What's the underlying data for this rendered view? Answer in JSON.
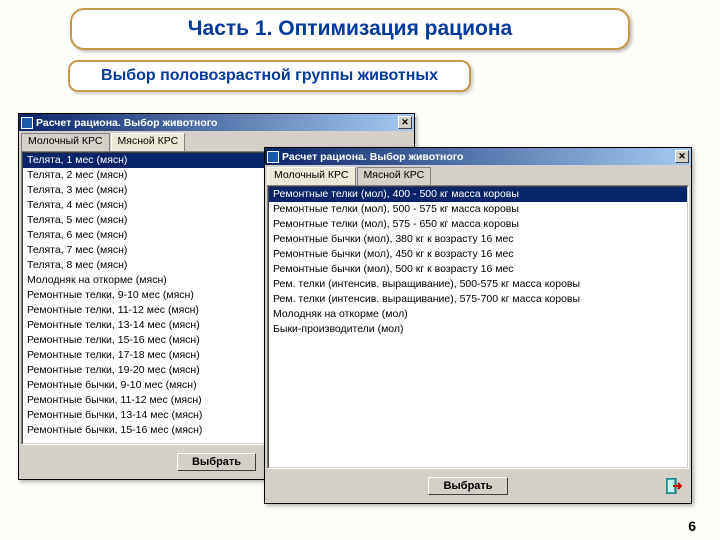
{
  "slide": {
    "title": "Часть 1. Оптимизация рациона",
    "subtitle": "Выбор половозрастной группы животных",
    "page_number": "6"
  },
  "window1": {
    "title": "Расчет рациона. Выбор животного",
    "tabs": [
      "Молочный КРС",
      "Мясной КРС"
    ],
    "active_tab": 1,
    "items": [
      "Телята, 1 мес (мясн)",
      "Телята, 2 мес (мясн)",
      "Телята, 3 мес (мясн)",
      "Телята, 4 мес (мясн)",
      "Телята, 5 мес (мясн)",
      "Телята, 6 мес (мясн)",
      "Телята, 7 мес (мясн)",
      "Телята, 8 мес (мясн)",
      "Молодняк на откорме (мясн)",
      "Ремонтные телки, 9-10 мес (мясн)",
      "Ремонтные телки, 11-12 мес (мясн)",
      "Ремонтные телки, 13-14 мес (мясн)",
      "Ремонтные телки, 15-16 мес (мясн)",
      "Ремонтные телки, 17-18 мес (мясн)",
      "Ремонтные телки, 19-20 мес (мясн)",
      "Ремонтные бычки, 9-10 мес (мясн)",
      "Ремонтные бычки, 11-12 мес (мясн)",
      "Ремонтные бычки, 13-14 мес (мясн)",
      "Ремонтные бычки, 15-16 мес (мясн)"
    ],
    "selected": 0,
    "select_button": "Выбрать"
  },
  "window2": {
    "title": "Расчет рациона. Выбор животного",
    "tabs": [
      "Молочный КРС",
      "Мясной КРС"
    ],
    "active_tab": 0,
    "items": [
      "Ремонтные телки (мол), 400 - 500 кг масса коровы",
      "Ремонтные телки (мол), 500 - 575 кг масса коровы",
      "Ремонтные телки (мол), 575 - 650 кг масса коровы",
      "Ремонтные бычки (мол), 380 кг к возрасту 16 мес",
      "Ремонтные бычки (мол), 450 кг к возрасту 16 мес",
      "Ремонтные бычки (мол), 500 кг к возрасту 16 мес",
      "Рем. телки (интенсив. выращивание), 500-575 кг масса коровы",
      "Рем. телки (интенсив. выращивание), 575-700 кг масса коровы",
      "Молодняк на откорме (мол)",
      "Быки-производители (мол)"
    ],
    "selected": 0,
    "select_button": "Выбрать"
  }
}
